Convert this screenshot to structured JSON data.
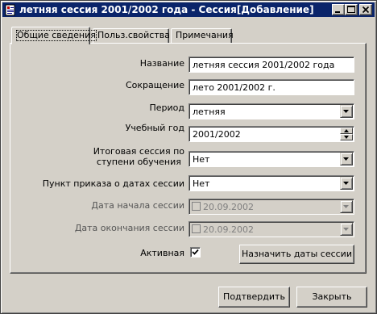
{
  "window": {
    "title": "летняя сессия 2001/2002 года - Сессия[Добавление]",
    "app_icon": "app-document-icon",
    "caption_buttons": [
      "minimize-icon",
      "maximize-icon",
      "close-icon"
    ]
  },
  "tabs": [
    {
      "label": "Общие сведения",
      "active": true
    },
    {
      "label": "Польз.свойства",
      "active": false
    },
    {
      "label": "Примечания",
      "active": false
    }
  ],
  "form": {
    "name": {
      "label": "Название",
      "value": "летняя сессия 2001/2002 года"
    },
    "abbreviation": {
      "label": "Сокращение",
      "value": "лето 2001/2002 г."
    },
    "period": {
      "label": "Период",
      "value": "летняя"
    },
    "academic_year": {
      "label": "Учебный год",
      "value": "2001/2002"
    },
    "final_session": {
      "label_line1": "Итоговая сессия по",
      "label_line2": "ступени обучения",
      "value": "Нет"
    },
    "order_item": {
      "label": "Пункт приказа о датах сессии",
      "value": "Нет"
    },
    "start_date": {
      "label": "Дата начала сессии",
      "value": "20.09.2002",
      "enabled": false
    },
    "end_date": {
      "label": "Дата окончания сессии",
      "value": "20.09.2002",
      "enabled": false
    },
    "active": {
      "label": "Активная",
      "checked": true
    }
  },
  "buttons": {
    "assign_dates": "Назначить даты сессии",
    "confirm": "Подтвердить",
    "close": "Закрыть"
  },
  "colors": {
    "titlebar": "#0a246a",
    "face": "#d4d0c8"
  }
}
